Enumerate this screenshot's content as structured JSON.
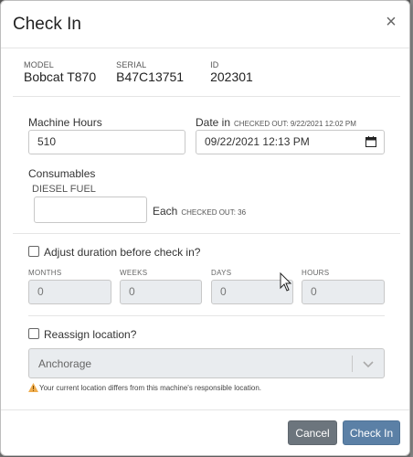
{
  "dialog": {
    "title": "Check In",
    "close_symbol": "×"
  },
  "machine": {
    "model_label": "MODEL",
    "model_value": "Bobcat T870",
    "serial_label": "SERIAL",
    "serial_value": "B47C13751",
    "id_label": "ID",
    "id_value": "202301"
  },
  "form": {
    "machine_hours_label": "Machine Hours",
    "machine_hours_value": "510",
    "date_in_label": "Date in",
    "checked_out_date": "CHECKED OUT: 9/22/2021 12:02 PM",
    "date_in_value": "09/22/2021 12:13  PM",
    "consumables_label": "Consumables",
    "consumable_item": "DIESEL FUEL",
    "consumable_value": "",
    "each_label": "Each",
    "checked_out_qty": "CHECKED OUT: 36"
  },
  "duration": {
    "checkbox_label": "Adjust duration before check in?",
    "checked": false,
    "months_label": "MONTHS",
    "weeks_label": "WEEKS",
    "days_label": "DAYS",
    "hours_label": "HOURS",
    "months_value": "0",
    "weeks_value": "0",
    "days_value": "0",
    "hours_value": "0"
  },
  "location": {
    "checkbox_label": "Reassign location?",
    "checked": false,
    "selected": "Anchorage",
    "warning": "Your current location differs from this machine's responsible location."
  },
  "footer": {
    "cancel_label": "Cancel",
    "checkin_label": "Check In"
  },
  "colors": {
    "primary": "#5b80a6",
    "secondary": "#6c757d",
    "warning": "#f0ad4e"
  }
}
